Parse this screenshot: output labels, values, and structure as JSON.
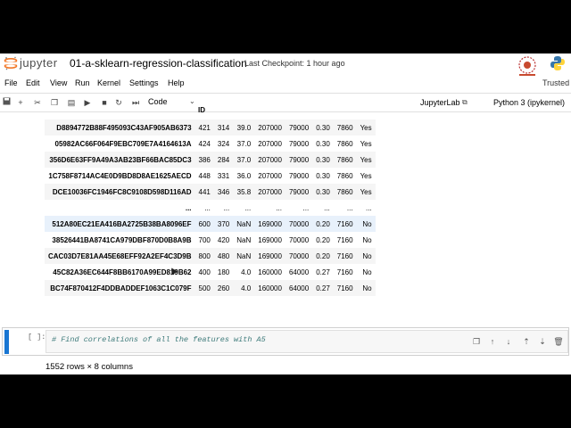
{
  "header": {
    "logo_text": "jupyter",
    "notebook_title": "01-a-sklearn-regression-classification",
    "checkpoint": "Last Checkpoint: 1 hour ago"
  },
  "menu": {
    "items": [
      "File",
      "Edit",
      "View",
      "Run",
      "Kernel",
      "Settings",
      "Help"
    ],
    "trusted": "Trusted"
  },
  "toolbar": {
    "cell_type": "Code",
    "jupyterlab": "JupyterLab",
    "kernel": "Python 3 (ipykernel)"
  },
  "table": {
    "index_name": "ID",
    "rows": [
      [
        "D8894772B88F495093C43AF905AB6373",
        "421",
        "314",
        "39.0",
        "207000",
        "79000",
        "0.30",
        "7860",
        "Yes"
      ],
      [
        "05982AC66F064F9EBC709E7A4164613A",
        "424",
        "324",
        "37.0",
        "207000",
        "79000",
        "0.30",
        "7860",
        "Yes"
      ],
      [
        "356D6E63FF9A49A3AB23BF66BAC85DC3",
        "386",
        "284",
        "37.0",
        "207000",
        "79000",
        "0.30",
        "7860",
        "Yes"
      ],
      [
        "1C758F8714AC4E0D9BD8D8AE1625AECD",
        "448",
        "331",
        "36.0",
        "207000",
        "79000",
        "0.30",
        "7860",
        "Yes"
      ],
      [
        "DCE10036FC1946FC8C9108D598D116AD",
        "441",
        "346",
        "35.8",
        "207000",
        "79000",
        "0.30",
        "7860",
        "Yes"
      ],
      [
        "...",
        "...",
        "...",
        "...",
        "...",
        "...",
        "...",
        "...",
        "..."
      ],
      [
        "512A80EC21EA416BA2725B38BA8096EF",
        "600",
        "370",
        "NaN",
        "169000",
        "70000",
        "0.20",
        "7160",
        "No"
      ],
      [
        "38526441BA8741CA979DBF870D0B8A9B",
        "700",
        "420",
        "NaN",
        "169000",
        "70000",
        "0.20",
        "7160",
        "No"
      ],
      [
        "CAC03D7E81AA45E68EFF92A2EF4C3D9B",
        "800",
        "480",
        "NaN",
        "169000",
        "70000",
        "0.20",
        "7160",
        "No"
      ],
      [
        "45C82A36EC644F8BB6170A99ED819B62",
        "400",
        "180",
        "4.0",
        "160000",
        "64000",
        "0.27",
        "7160",
        "No"
      ],
      [
        "BC74F870412F4DDBADDEF1063C1C079F",
        "500",
        "260",
        "4.0",
        "160000",
        "64000",
        "0.27",
        "7160",
        "No"
      ]
    ],
    "summary": "1552 rows × 8 columns"
  },
  "cell": {
    "prompt": "[ ]:",
    "code": "# Find correlations of all the features with A5"
  },
  "colors": {
    "active_cell_bar": "#1976d2",
    "comment": "#3d7a7a",
    "logo_orange": "#f37726"
  }
}
